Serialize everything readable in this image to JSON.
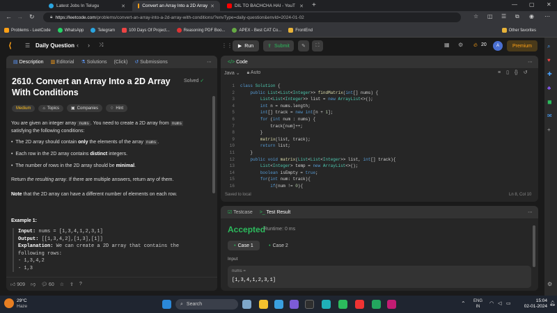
{
  "browser": {
    "tabs": [
      {
        "label": "Latest Jobs In Telugu",
        "active": false
      },
      {
        "label": "Convert an Array Into a 2D Array",
        "active": true
      },
      {
        "label": "DIL TO BACHCHA HAI - YouT",
        "active": false
      }
    ],
    "url_host": "https://leetcode.com",
    "url_path": "/problems/convert-an-array-into-a-2d-array-with-conditions/?envType=daily-question&envId=2024-01-02",
    "bookmarks": [
      "Problems - LeetCode",
      "WhatsApp",
      "Telegram",
      "100 Days Of Project...",
      "Reasoning PDF Boo...",
      "APEX - Best CAT Co...",
      "FrontEnd"
    ],
    "other_favorites": "Other favorites"
  },
  "app": {
    "nav_title": "Daily Question",
    "run_label": "Run",
    "submit_label": "Submit",
    "streak": "20",
    "avatar_letter": "A",
    "premium_label": "Premium"
  },
  "problem": {
    "tabs": [
      "Description",
      "Editorial",
      "Solutions",
      "(Click)",
      "Submissions"
    ],
    "title": "2610. Convert an Array Into a 2D Array With Conditions",
    "solved_label": "Solved",
    "difficulty": "Medium",
    "chips": [
      "Topics",
      "Companies",
      "Hint"
    ],
    "intro_a": "You are given an integer array",
    "intro_code": "nums",
    "intro_b": ". You need to create a 2D array from",
    "intro_code2": "nums",
    "intro_c": "satisfying the following conditions:",
    "bullet1_a": "The 2D array should contain",
    "bullet1_b": "only",
    "bullet1_c": "the elements of the array",
    "bullet1_code": "nums",
    "bullet2_a": "Each row in the 2D array contains",
    "bullet2_b": "distinct",
    "bullet2_c": "integers.",
    "bullet3_a": "The number of rows in the 2D array should be",
    "bullet3_b": "minimal",
    "return_a": "Return",
    "return_b": "the resulting array",
    "return_c": ". If there are multiple answers, return any of them.",
    "note_b": "Note",
    "note_rest": "that the 2D array can have a different number of elements on each row.",
    "example_title": "Example 1:",
    "ex_input_label": "Input:",
    "ex_input": "nums = [1,3,4,1,2,3,1]",
    "ex_output_label": "Output:",
    "ex_output": "[[1,3,4,2],[1,3],[1]]",
    "ex_expl_label": "Explanation:",
    "ex_expl1": "We can create a 2D array that contains the",
    "ex_expl2": "following rows:",
    "ex_row1": "- 1,3,4,2",
    "ex_row2": "- 1,3",
    "likes": "909",
    "comments": "60"
  },
  "editor": {
    "header": "Code",
    "language": "Java",
    "mode": "Auto",
    "lines": [
      "class Solution {",
      "    public List<List<Integer>> findMatrix(int[] nums) {",
      "        List<List<Integer>> list = new ArrayList<>();",
      "        int n = nums.length;",
      "        int[] track = new int[n + 1];",
      "        for (int num : nums) {",
      "            track[num]++;",
      "        }",
      "        matrix(list, track);",
      "        return list;",
      "    }",
      "    public void matrix(List<List<Integer>> list, int[] track){",
      "        List<Integer> temp = new ArrayList<>();",
      "        boolean isEmpty = true;",
      "        for(int num: track){",
      "            if(num != 0){"
    ],
    "saved": "Saved to local",
    "cursor": "Ln 8, Col 10"
  },
  "result": {
    "tab_testcase": "Testcase",
    "tab_result": "Test Result",
    "status": "Accepted",
    "runtime": "Runtime: 0 ms",
    "cases": [
      "Case 1",
      "Case 2"
    ],
    "input_label": "Input",
    "var_name": "nums =",
    "var_value": "[1,3,4,1,2,3,1]"
  },
  "taskbar": {
    "weather_temp": "29°C",
    "weather_desc": "Haze",
    "search_placeholder": "Search",
    "lang1": "ENG",
    "lang2": "IN",
    "time": "15:04",
    "date": "02-01-2024"
  },
  "colors": {
    "accepted": "#2cbb5d",
    "medium": "#ffc01e",
    "run_bg": "#3b3b3b",
    "submit": "#2cbb5d"
  }
}
